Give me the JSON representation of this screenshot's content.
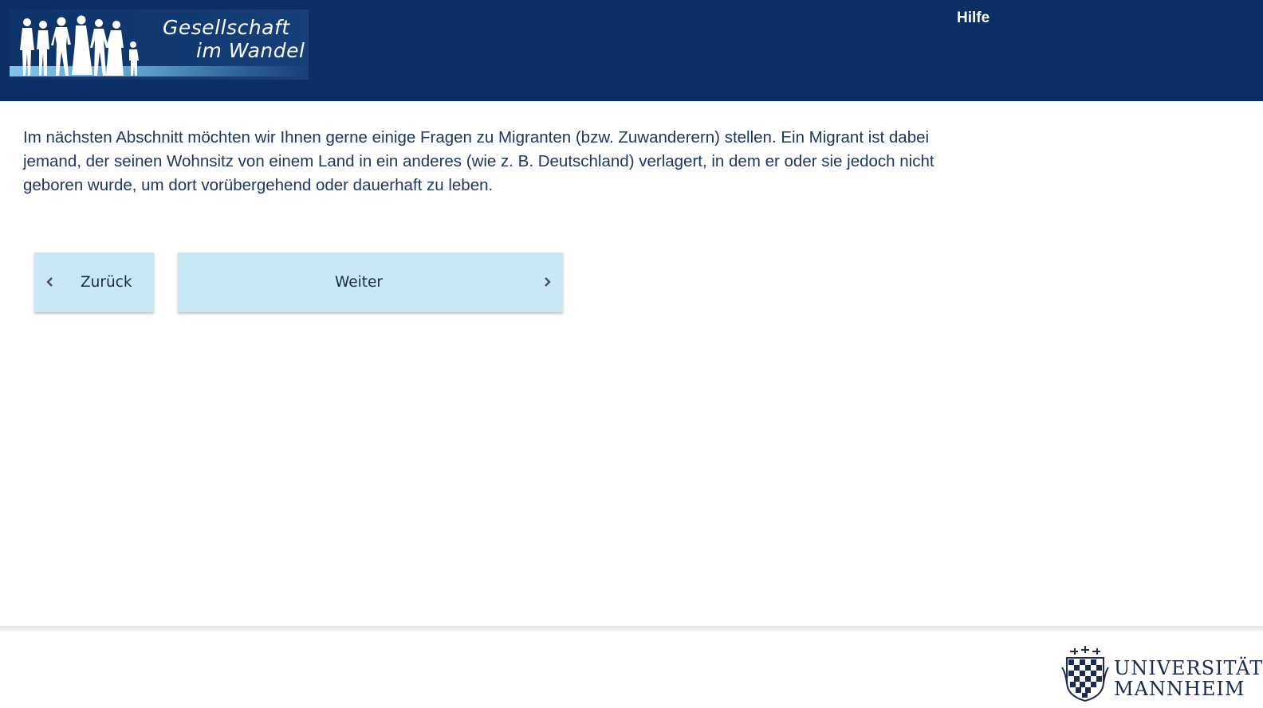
{
  "header": {
    "logo": {
      "line1": "Gesellschaft",
      "line2": "im Wandel",
      "icon": "people-silhouettes-icon"
    },
    "help_link": "Hilfe"
  },
  "main": {
    "intro_text": "Im nächsten Abschnitt möchten wir Ihnen gerne einige Fragen zu Migranten (bzw. Zuwanderern) stellen. Ein Migrant ist dabei jemand, der seinen Wohnsitz von einem Land in ein anderes (wie z. B. Deutschland) verlagert, in dem er oder sie jedoch nicht geboren wurde, um dort vorübergehend oder dauerhaft zu leben."
  },
  "navigation": {
    "back_label": "Zurück",
    "back_icon": "chevron-left-icon",
    "next_label": "Weiter",
    "next_icon": "chevron-right-icon"
  },
  "footer": {
    "university_line1": "UNIVERSITÄT",
    "university_line2": "MANNHEIM",
    "crest_icon": "university-crest-icon"
  },
  "colors": {
    "header_bg": "#0b2f64",
    "button_bg": "#c8e8f5",
    "text": "#1f3563"
  }
}
